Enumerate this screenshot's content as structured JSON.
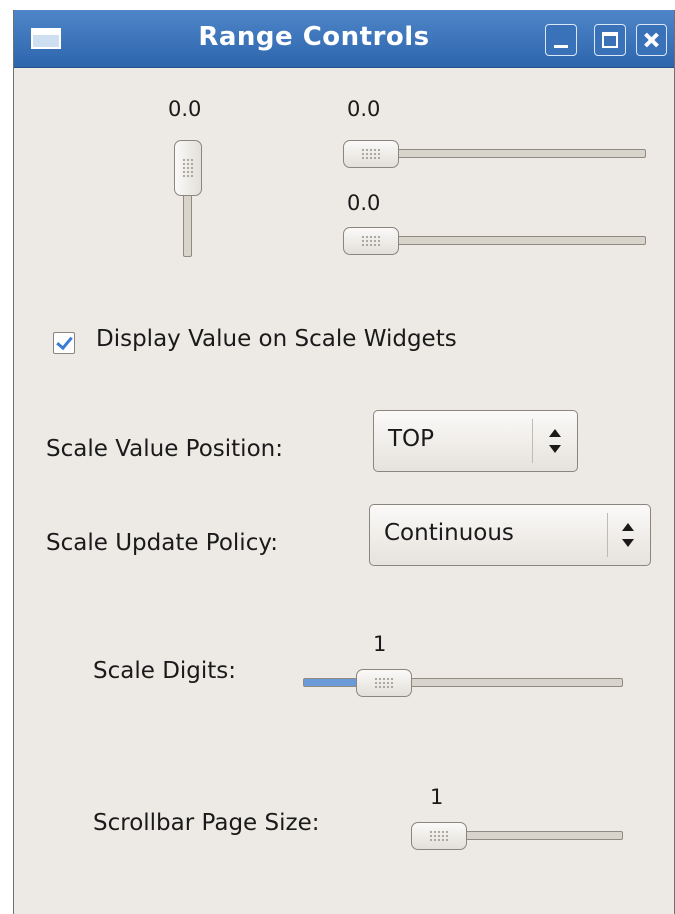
{
  "window": {
    "title": "Range Controls",
    "icon": "window-icon",
    "buttons": [
      "minimize-icon",
      "maximize-icon",
      "close-icon"
    ]
  },
  "scales": {
    "vertical_value": "0.0",
    "horizontal_top_value": "0.0",
    "horizontal_bottom_value": "0.0",
    "value_fraction": 0
  },
  "options": {
    "display_value_label": "Display Value on Scale Widgets",
    "display_value_checked": true,
    "value_position_label": "Scale Value Position:",
    "value_position_selected": "TOP",
    "update_policy_label": "Scale Update Policy:",
    "update_policy_selected": "Continuous",
    "digits_label": "Scale Digits:",
    "digits_value": "1",
    "digits_fraction": 0.2,
    "page_size_label": "Scrollbar Page Size:",
    "page_size_value": "1",
    "page_size_fraction": 0
  },
  "colors": {
    "titlebar": "#3a72ba",
    "window_bg": "#edeae6",
    "accent": "#6a9bd8",
    "check": "#3a7bd5"
  }
}
